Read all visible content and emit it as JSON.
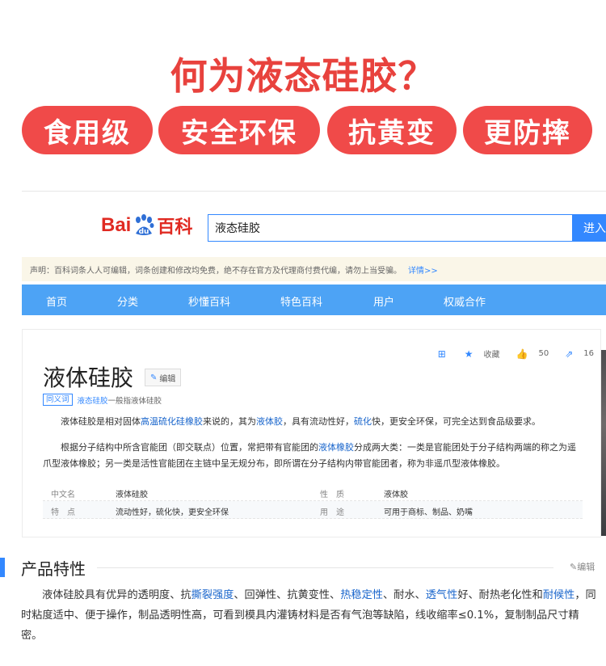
{
  "hero": {
    "title": "何为液态硅胶？",
    "features": [
      "食用级",
      "安全环保",
      "抗黄变",
      "更防摔"
    ]
  },
  "colors": {
    "accent_red": "#f04a49",
    "brand_blue": "#3388ff",
    "nav_blue": "#4da3f5"
  },
  "baike": {
    "logo": {
      "bai": "Bai",
      "du": "du",
      "baike": "百科"
    },
    "search": {
      "value": "液态硅胶",
      "button": "进入"
    },
    "notice": {
      "text": "声明：百科词条人人可编辑，词条创建和修改均免费，绝不存在官方及代理商付费代编，请勿上当受骗。",
      "more": "详情>>"
    },
    "nav": [
      "首页",
      "分类",
      "秒懂百科",
      "特色百科",
      "用户",
      "权威合作"
    ],
    "entry": {
      "tools": {
        "collect": "收藏",
        "likes": "50",
        "shares": "16"
      },
      "title": "液体硅胶",
      "edit_label": "编辑",
      "synonym_tag": "同义词",
      "synonym_link": "液态硅胶",
      "synonym_text": "一般指液体硅胶",
      "para1": {
        "s1": "液体硅胶是相对固体",
        "l1": "高温硫化硅橡胶",
        "s2": "来说的，其为",
        "l2": "液体胶",
        "s3": "，具有流动性好，",
        "l3": "硫化",
        "s4": "快，更安全环保，可完全达到食品级要求。"
      },
      "para2": {
        "s1": "根据分子结构中所含官能团（即交联点）位置，常把带有官能团的",
        "l1": "液体橡胶",
        "s2": "分成两大类：一类是官能团处于分子结构两端的称之为遥爪型液体橡胶；另一类是活性官能团在主链中呈无规分布，即所谓在分子结构内带官能团者，称为非遥爪型液体橡胶。"
      },
      "table": [
        {
          "k1": "中文名",
          "v1": "液体硅胶",
          "k2": "性　质",
          "v2": "液体胶"
        },
        {
          "k1": "特　点",
          "v1": "流动性好，硫化快，更安全环保",
          "k2": "用　途",
          "v2": "可用于商标、制品、奶嘴"
        }
      ]
    }
  },
  "product": {
    "title": "产品特性",
    "edit_label": "编辑",
    "text": {
      "s1": "液体硅胶具有优异的透明度、抗",
      "l1": "撕裂强度",
      "s2": "、回弹性、抗黄变性、",
      "l2": "热稳定性",
      "s3": "、耐水、",
      "l3": "透气性",
      "s4": "好、耐热老化性和",
      "l4": "耐候性",
      "s5": "，同时粘度适中、便于操作，制品透明性高，可看到模具内灌铸材料是否有气泡等缺陷，线收缩率≤0.1%，复制制品尺寸精密。"
    }
  }
}
